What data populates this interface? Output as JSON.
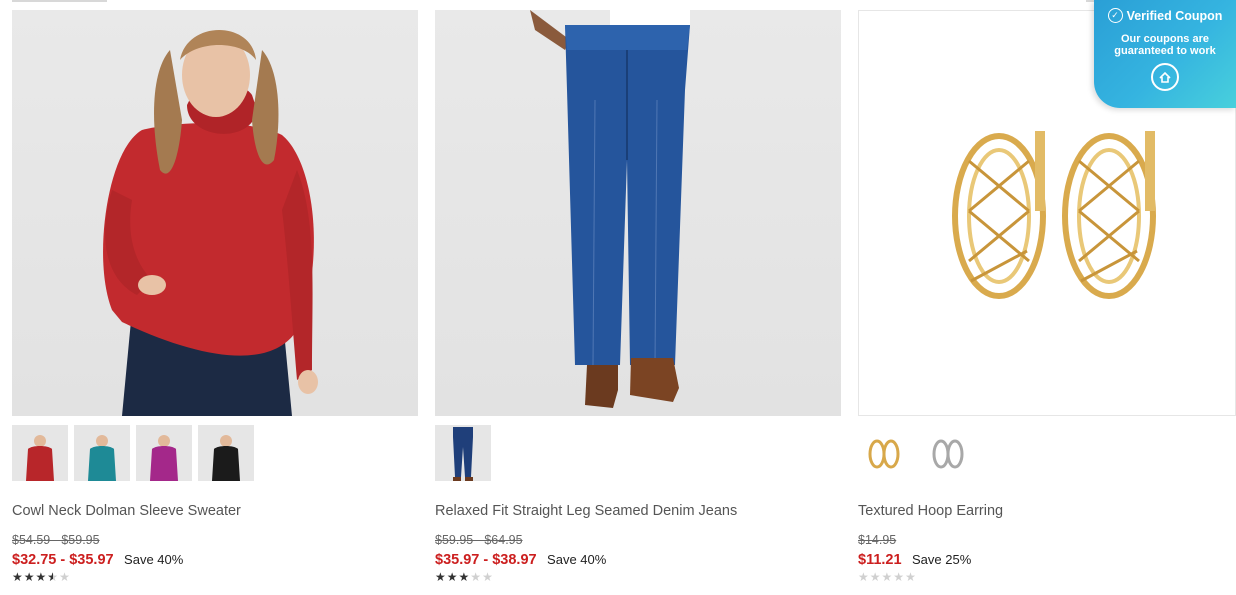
{
  "products": [
    {
      "name": "Cowl Neck Dolman Sleeve Sweater",
      "original_price": "$54.59 - $59.95",
      "sale_price": "$32.75 - $35.97",
      "save_text": "Save 40%",
      "rating": 3.5,
      "swatches": [
        {
          "color": "#b8262a"
        },
        {
          "color": "#1e8a96"
        },
        {
          "color": "#a4288a"
        },
        {
          "color": "#1b1b1b"
        }
      ]
    },
    {
      "name": "Relaxed Fit Straight Leg Seamed Denim Jeans",
      "original_price": "$59.95 - $64.95",
      "sale_price": "$35.97 - $38.97",
      "save_text": "Save 40%",
      "rating": 3,
      "swatches": [
        {
          "color": "#1f3f7a"
        }
      ]
    },
    {
      "name": "Textured Hoop Earring",
      "original_price": "$14.95",
      "sale_price": "$11.21",
      "save_text": "Save 25%",
      "rating": 0,
      "swatches": [
        {
          "color": "#d8a84a"
        },
        {
          "color": "#a8a8a8"
        }
      ]
    }
  ],
  "coupon_badge": {
    "title": "Verified Coupon",
    "subtitle": "Our coupons are guaranteed to work"
  },
  "colors": {
    "sale_red": "#cc1f1f",
    "coupon_gradient_start": "#2a9fd6",
    "coupon_gradient_end": "#48d0dc"
  }
}
